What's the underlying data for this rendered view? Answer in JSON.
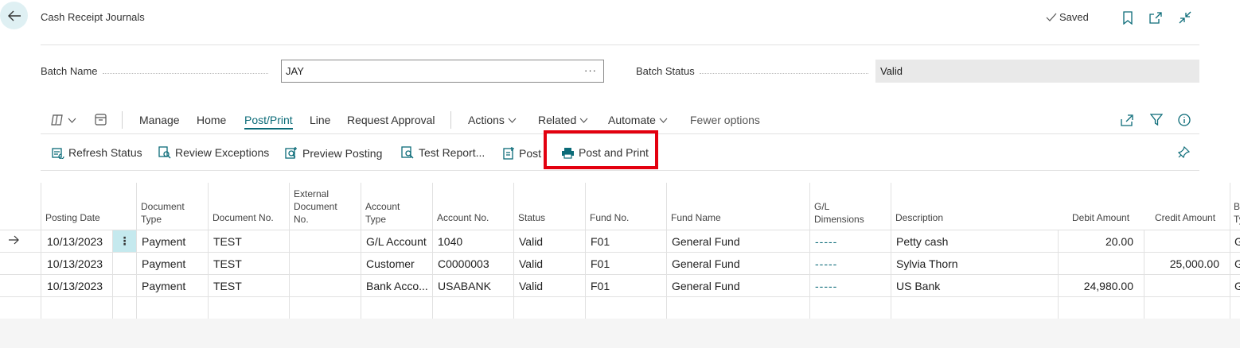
{
  "header": {
    "title": "Cash Receipt Journals",
    "saved_label": "Saved"
  },
  "fields": {
    "batch_name_label": "Batch Name",
    "batch_name_value": "JAY",
    "batch_name_more": "···",
    "batch_status_label": "Batch Status",
    "batch_status_value": "Valid"
  },
  "action_bar": {
    "manage": "Manage",
    "home": "Home",
    "post_print": "Post/Print",
    "line": "Line",
    "request_approval": "Request Approval",
    "actions": "Actions",
    "related": "Related",
    "automate": "Automate",
    "fewer_options": "Fewer options"
  },
  "sub_actions": {
    "refresh_status": "Refresh Status",
    "review_exceptions": "Review Exceptions",
    "preview_posting": "Preview Posting",
    "test_report": "Test Report...",
    "post": "Post",
    "post_and_print": "Post and Print"
  },
  "highlight_color": "#e3000f",
  "accent_color": "#0b6b78",
  "table": {
    "headers": {
      "posting_date": "Posting Date",
      "document_type_1": "Document",
      "document_type_2": "Type",
      "document_no": "Document No.",
      "external_doc_1": "External",
      "external_doc_2": "Document",
      "external_doc_3": "No.",
      "account_type_1": "Account",
      "account_type_2": "Type",
      "account_no": "Account No.",
      "status": "Status",
      "fund_no": "Fund No.",
      "fund_name": "Fund Name",
      "gl_dimensions_1": "G/L",
      "gl_dimensions_2": "Dimensions",
      "description": "Description",
      "debit_amount": "Debit Amount",
      "credit_amount": "Credit Amount",
      "bal_1": "Ba",
      "bal_2": "Ty"
    },
    "rows": [
      {
        "posting_date": "10/13/2023",
        "document_type": "Payment",
        "document_no": "TEST",
        "account_type": "G/L Account",
        "account_no": "1040",
        "status": "Valid",
        "fund_no": "F01",
        "fund_name": "General Fund",
        "dimensions": "-----",
        "description": "Petty cash",
        "debit": "20.00",
        "credit": "",
        "bal": "G"
      },
      {
        "posting_date": "10/13/2023",
        "document_type": "Payment",
        "document_no": "TEST",
        "account_type": "Customer",
        "account_no": "C0000003",
        "status": "Valid",
        "fund_no": "F01",
        "fund_name": "General Fund",
        "dimensions": "-----",
        "description": "Sylvia Thorn",
        "debit": "",
        "credit": "25,000.00",
        "bal": "G"
      },
      {
        "posting_date": "10/13/2023",
        "document_type": "Payment",
        "document_no": "TEST",
        "account_type": "Bank Acco...",
        "account_no": "USABANK",
        "status": "Valid",
        "fund_no": "F01",
        "fund_name": "General Fund",
        "dimensions": "-----",
        "description": "US Bank",
        "debit": "24,980.00",
        "credit": "",
        "bal": "G"
      }
    ],
    "row_menu_glyph": "⋮"
  }
}
